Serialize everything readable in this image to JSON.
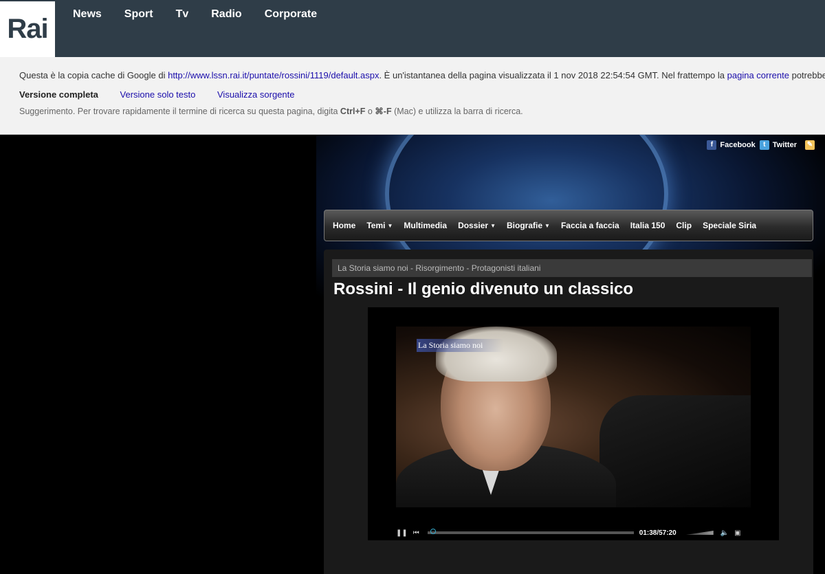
{
  "rai": {
    "logo": "Rai",
    "nav": [
      "News",
      "Sport",
      "Tv",
      "Radio",
      "Corporate"
    ]
  },
  "cache": {
    "prefix": "Questa è la copia cache di Google di ",
    "url": "http://www.lssn.rai.it/puntate/rossini/1119/default.aspx",
    "middle": ". È un'istantanea della pagina visualizzata il 1 nov 2018 22:54:54 GMT. Nel frattempo la ",
    "current_link": "pagina corrente",
    "suffix": " potrebbe",
    "full_version": "Versione completa",
    "text_version": "Versione solo testo",
    "view_source": "Visualizza sorgente",
    "tip_pre": "Suggerimento. Per trovare rapidamente il termine di ricerca su questa pagina, digita ",
    "tip_ctrl": "Ctrl+F",
    "tip_or": " o ",
    "tip_cmd": "⌘-F",
    "tip_post": " (Mac) e utilizza la barra di ricerca."
  },
  "social": {
    "facebook": "Facebook",
    "twitter": "Twitter"
  },
  "site_nav": [
    {
      "label": "Home",
      "dropdown": false
    },
    {
      "label": "Temi",
      "dropdown": true
    },
    {
      "label": "Multimedia",
      "dropdown": false
    },
    {
      "label": "Dossier",
      "dropdown": true
    },
    {
      "label": "Biografie",
      "dropdown": true
    },
    {
      "label": "Faccia a faccia",
      "dropdown": false
    },
    {
      "label": "Italia 150",
      "dropdown": false
    },
    {
      "label": "Clip",
      "dropdown": false
    },
    {
      "label": "Speciale Siria",
      "dropdown": false
    }
  ],
  "breadcrumb": "La Storia siamo noi - Risorgimento - Protagonisti italiani",
  "title": "Rossini - Il genio divenuto un classico",
  "video": {
    "watermark": "La Storia siamo noi",
    "time": "01:38/57:20"
  }
}
